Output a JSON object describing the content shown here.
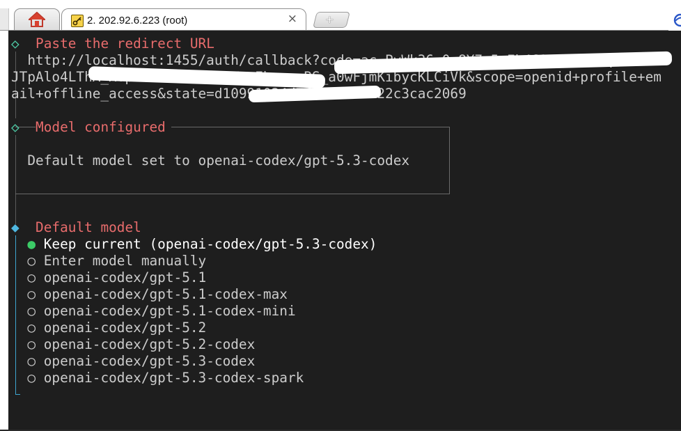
{
  "tabs": {
    "home_icon": "home-icon",
    "session_tab": {
      "icon": "key-icon",
      "title": "2. 202.92.6.223 (root)",
      "close": "×"
    },
    "new_tab": "+"
  },
  "terminal": {
    "paste_step": {
      "marker": "◇",
      "title": "Paste the redirect URL",
      "url_lines": [
        "  http://localhost:1455/auth/callback?code=ac_PyWk36_0g8Y7o5uEb462mWi3SSbqAswaD",
        "JTpAlo4LThA_MTpr8Ke4Dh0FNuRWpwEb_p_pBS_a0wFjmKibycKLCiVk&scope=openid+profile+em",
        "ail+offline_access&state=d10991024d7f0023533222c3cac2069"
      ],
      "gutter": "│"
    },
    "model_configured": {
      "marker": "◇",
      "title": "Model configured",
      "message": "Default model set to openai-codex/gpt-5.3-codex"
    },
    "default_model": {
      "marker": "◆",
      "title": "Default model",
      "selected_marker": "●",
      "unselected_marker": "○",
      "options": [
        "Keep current (openai-codex/gpt-5.3-codex)",
        "Enter model manually",
        "openai-codex/gpt-5.1",
        "openai-codex/gpt-5.1-codex-max",
        "openai-codex/gpt-5.1-codex-mini",
        "openai-codex/gpt-5.2",
        "openai-codex/gpt-5.2-codex",
        "openai-codex/gpt-5.3-codex",
        "openai-codex/gpt-5.3-codex-spark"
      ],
      "selected_index": 0
    }
  },
  "colors": {
    "terminal_bg": "#1e1e1e",
    "heading_red": "#e86c6c",
    "diamond_green": "#4ec9a5",
    "active_blue": "#3ea6d2",
    "selected_green": "#3ccb67"
  }
}
